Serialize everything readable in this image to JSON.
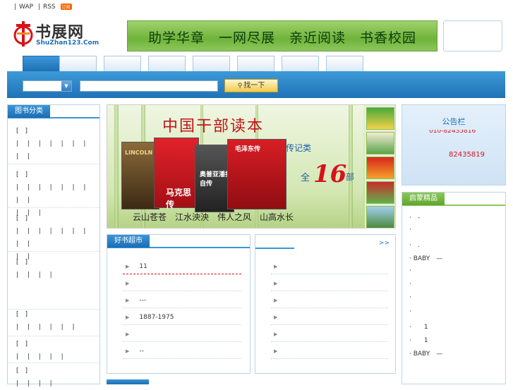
{
  "top_links": {
    "wap": "WAP",
    "rss": "RSS",
    "rss_badge": "订阅",
    "sep": "|"
  },
  "logo": {
    "name_cn": "书展网",
    "name_en": "ShuZhan123.Com"
  },
  "banner": {
    "slogan": "助学华章　一网尽展　亲近阅读　书香校园"
  },
  "search": {
    "button_label": "找一下",
    "select_value": "",
    "input_value": ""
  },
  "colors": {
    "primary_blue": "#1f72b6",
    "accent_green": "#6fb33a",
    "red": "#d8121a"
  },
  "left_panel": {
    "title": "图书分类",
    "categories": [
      {
        "head": "[　]",
        "lines": [
          "| | | | | | | | |"
        ]
      },
      {
        "head": "[　]",
        "lines": [
          "| | | | | | | | |",
          "| | |"
        ]
      },
      {
        "head": "[　]",
        "lines": [
          "| | | | | | | | |",
          "| |"
        ]
      },
      {
        "head": "[　]",
        "lines": [
          "| | | |"
        ]
      },
      {
        "head": "[　]",
        "lines": [
          "| | | | | |"
        ]
      },
      {
        "head": "[　]",
        "lines": [
          "| | | | |"
        ]
      },
      {
        "head": "[　]",
        "lines": [
          "| | | |"
        ]
      }
    ]
  },
  "promo": {
    "title": "中国干部读本",
    "sub": "传记类",
    "all": "全",
    "number": "16",
    "unit": "部",
    "slogan": "云山苍苍　江水泱泱　伟人之风　山高水长",
    "books": [
      "LINCOLN",
      "马克思传",
      "奥普亚潘拉自传",
      "毛泽东传"
    ]
  },
  "notice": {
    "title": "公告栏",
    "phone1": "010-82435816",
    "phone2": "82435819"
  },
  "enlighten": {
    "title": "启蒙精品",
    "items": [
      "·　-",
      "·",
      "·　.",
      "· BABY　—",
      "·",
      "·",
      "·",
      "·",
      "·　　1",
      "·　　1",
      "· BABY　—"
    ]
  },
  "market": {
    "title": "好书超市",
    "rows": [
      "11",
      "",
      "---",
      "1887-1975",
      "",
      "--"
    ]
  },
  "right_box": {
    "more": ">>",
    "rows": [
      "",
      "",
      "",
      "",
      "",
      ""
    ]
  }
}
